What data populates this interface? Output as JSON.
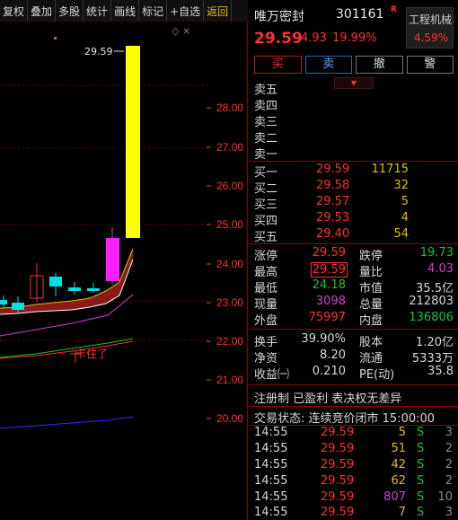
{
  "toolbar": {
    "items": [
      "复权",
      "叠加",
      "多股",
      "统计",
      "画线",
      "标记",
      "+自选",
      "返回"
    ]
  },
  "chart": {
    "peak_label": "29.59",
    "annotation": "卡住了",
    "y_axis": [
      "28.00",
      "27.00",
      "26.00",
      "25.00",
      "24.00",
      "23.00",
      "22.00",
      "21.00",
      "20.00"
    ],
    "colors": {
      "up": "#ff3030",
      "down": "#00e0e0",
      "limit_up": "#ffff00",
      "axis": "#ff3030",
      "grid": "#8b0000"
    }
  },
  "stock": {
    "name": "唯万密封",
    "code": "301161",
    "mark": "R",
    "price": "29.59",
    "change": "4.93",
    "change_pct": "19.99%",
    "industry": "工程机械",
    "industry_pct": "4.59%"
  },
  "trade_buttons": {
    "buy": "买",
    "sell": "卖",
    "cancel": "撤",
    "alert": "警"
  },
  "sell_book": [
    {
      "label": "卖五",
      "price": "",
      "vol": ""
    },
    {
      "label": "卖四",
      "price": "",
      "vol": ""
    },
    {
      "label": "卖三",
      "price": "",
      "vol": ""
    },
    {
      "label": "卖二",
      "price": "",
      "vol": ""
    },
    {
      "label": "卖一",
      "price": "",
      "vol": ""
    }
  ],
  "buy_book": [
    {
      "label": "买一",
      "price": "29.59",
      "vol": "11715"
    },
    {
      "label": "买二",
      "price": "29.58",
      "vol": "32"
    },
    {
      "label": "买三",
      "price": "29.57",
      "vol": "5"
    },
    {
      "label": "买四",
      "price": "29.53",
      "vol": "4"
    },
    {
      "label": "买五",
      "price": "29.40",
      "vol": "54"
    }
  ],
  "quote": {
    "limit_up_label": "涨停",
    "limit_up": "29.59",
    "limit_down_label": "跌停",
    "limit_down": "19.73",
    "high_label": "最高",
    "high": "29.59",
    "vol_ratio_label": "量比",
    "vol_ratio": "4.03",
    "low_label": "最低",
    "low": "24.18",
    "mkt_cap_label": "市值",
    "mkt_cap": "35.5亿",
    "cur_vol_label": "现量",
    "cur_vol": "3098",
    "total_vol_label": "总量",
    "total_vol": "212803",
    "outer_label": "外盘",
    "outer": "75997",
    "inner_label": "内盘",
    "inner": "136806"
  },
  "fundamentals": {
    "turnover_label": "换手",
    "turnover": "39.90%",
    "shares_label": "股本",
    "shares": "1.20亿",
    "nav_label": "净资",
    "nav": "8.20",
    "float_label": "流通",
    "float": "5333万",
    "eps_label": "收益㈠",
    "eps": "0.210",
    "pe_label": "PE(动)",
    "pe": "35.8"
  },
  "tags": "注册制 已盈利 表决权无差异",
  "trade_status": "交易状态: 连续竞价闭市 15:00:00",
  "ticks": [
    {
      "time": "14:55",
      "price": "29.59",
      "vol": "5",
      "side": "S",
      "n": "3"
    },
    {
      "time": "14:55",
      "price": "29.59",
      "vol": "51",
      "side": "S",
      "n": "2"
    },
    {
      "time": "14:55",
      "price": "29.59",
      "vol": "42",
      "side": "S",
      "n": "2"
    },
    {
      "time": "14:55",
      "price": "29.59",
      "vol": "62",
      "side": "S",
      "n": "2"
    },
    {
      "time": "14:55",
      "price": "29.59",
      "vol": "807",
      "side": "S",
      "n": "10"
    },
    {
      "time": "14:55",
      "price": "29.59",
      "vol": "7",
      "side": "S",
      "n": "3"
    }
  ]
}
